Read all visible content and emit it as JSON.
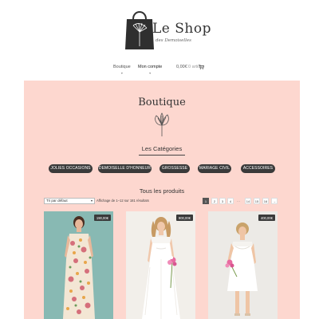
{
  "header": {
    "brand": "Le Shop",
    "tagline": "des Demoiselles"
  },
  "nav": {
    "items": [
      {
        "label": "Boutique",
        "caret": "▾"
      },
      {
        "label": "Mon compte",
        "caret": "▾"
      }
    ],
    "cart_amount": "0,00€",
    "cart_count": "0 article",
    "cart_icon": "cart-icon"
  },
  "main": {
    "title": "Boutique",
    "categories_heading": "Les Catégories",
    "categories": [
      "JOLIES OCCASIONS",
      "DEMOISELLE D'HONNEUR",
      "GROSSESSE",
      "MARIAGE CIVIL",
      "ACCESSOIRES"
    ],
    "products_heading": "Tous les produits",
    "sort_value": "Tri par défaut",
    "result_count": "Affichage de 1–12 sur 181 résultats",
    "pagination": [
      "1",
      "2",
      "3",
      "4",
      "…",
      "14",
      "15",
      "16",
      "→"
    ],
    "active_page": "1",
    "products": [
      {
        "price": "190,00€"
      },
      {
        "price": "900,00€"
      },
      {
        "price": "400,00€"
      }
    ]
  },
  "colors": {
    "pink_background": "#fdd7cf",
    "pill_dark": "#3a3a3a"
  }
}
